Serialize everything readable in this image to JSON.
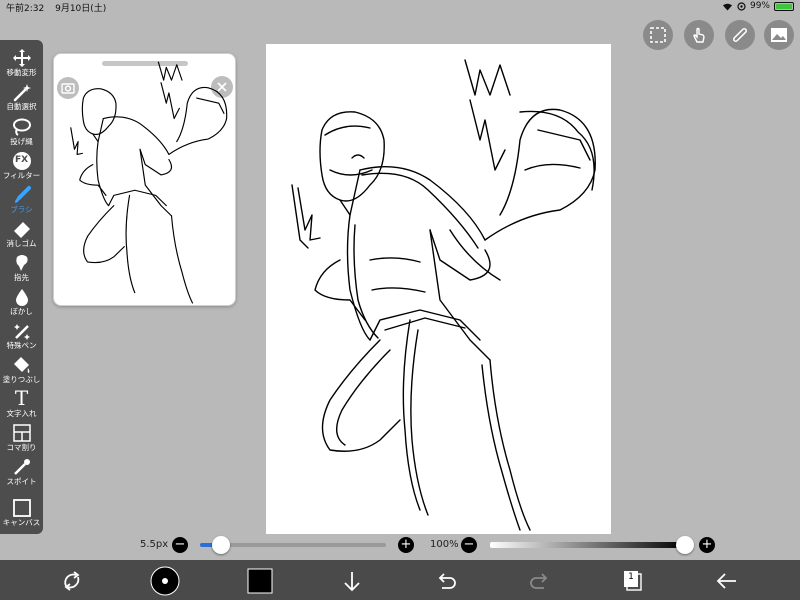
{
  "status": {
    "time": "午前2:32",
    "date": "9月10日(土)",
    "battery": "99%"
  },
  "toolbar": {
    "items": [
      {
        "label": "移動変形",
        "icon": "move-arrows-icon"
      },
      {
        "label": "自動選択",
        "icon": "magic-wand-icon"
      },
      {
        "label": "投げ縄",
        "icon": "lasso-icon"
      },
      {
        "label": "フィルター",
        "icon": "fx-icon"
      },
      {
        "label": "ブラシ",
        "icon": "brush-icon",
        "active": true
      },
      {
        "label": "消しゴム",
        "icon": "eraser-icon"
      },
      {
        "label": "指先",
        "icon": "smudge-icon"
      },
      {
        "label": "ぼかし",
        "icon": "blur-drop-icon"
      },
      {
        "label": "特殊ペン",
        "icon": "special-pen-icon"
      },
      {
        "label": "塗りつぶし",
        "icon": "bucket-fill-icon"
      },
      {
        "label": "文字入れ",
        "icon": "text-icon"
      },
      {
        "label": "コマ割り",
        "icon": "frame-divide-icon"
      },
      {
        "label": "スポイト",
        "icon": "eyedropper-icon"
      },
      {
        "label": "キャンバス",
        "icon": "canvas-icon"
      }
    ]
  },
  "fx_glyph": "FX",
  "text_glyph": "T",
  "brush_size": {
    "label": "5.5px",
    "value_fraction": 0.08
  },
  "opacity": {
    "label": "100%",
    "value_fraction": 1.0
  },
  "minus_glyph": "−",
  "plus_glyph": "+",
  "layer_count": "1",
  "colors": {
    "accent": "#3aa3ff",
    "toolbar": "#4d4d4d",
    "bottombar": "#4a4a4a",
    "background": "#b9b9b9",
    "brush_color": "#000000"
  }
}
